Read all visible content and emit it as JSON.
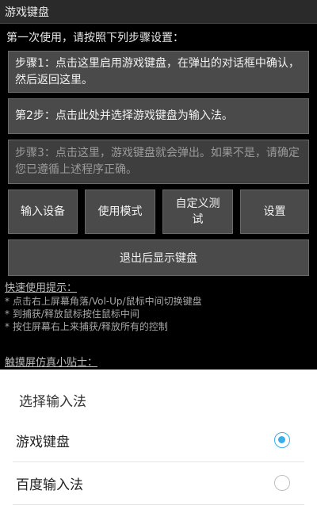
{
  "app": {
    "title": "游戏键盘"
  },
  "intro": "第一次使用，请按照下列步骤设置：",
  "steps": [
    {
      "text": "步骤1：点击这里启用游戏键盘，在弹出的对话框中确认，然后返回这里。"
    },
    {
      "text": "第2步：点击此处并选择游戏键盘为输入法。"
    },
    {
      "text": "步骤3：点击这里，游戏键盘就会弹出。如果不是，请确定您已遵循上述程序正确。"
    }
  ],
  "buttons": {
    "input_device": "输入设备",
    "use_mode": "使用模式",
    "custom_test": "自定义测试",
    "settings": "设置",
    "exit_show_keyboard": "退出后显示键盘"
  },
  "tips": {
    "heading": "快速使用提示：",
    "items": [
      "* 点击右上屏幕角落/Vol-Up/鼠标中间切换键盘",
      "* 到捕获/释放鼠标按住鼠标中间",
      "* 按住屏幕右上来捕获/释放所有的控制"
    ],
    "touch_heading": "触摸屏仿真小贴士："
  },
  "ime_dialog": {
    "title": "选择输入法",
    "options": [
      {
        "label": "游戏键盘",
        "selected": true
      },
      {
        "label": "百度输入法",
        "selected": false
      }
    ],
    "accent_color": "#36b0e6"
  }
}
